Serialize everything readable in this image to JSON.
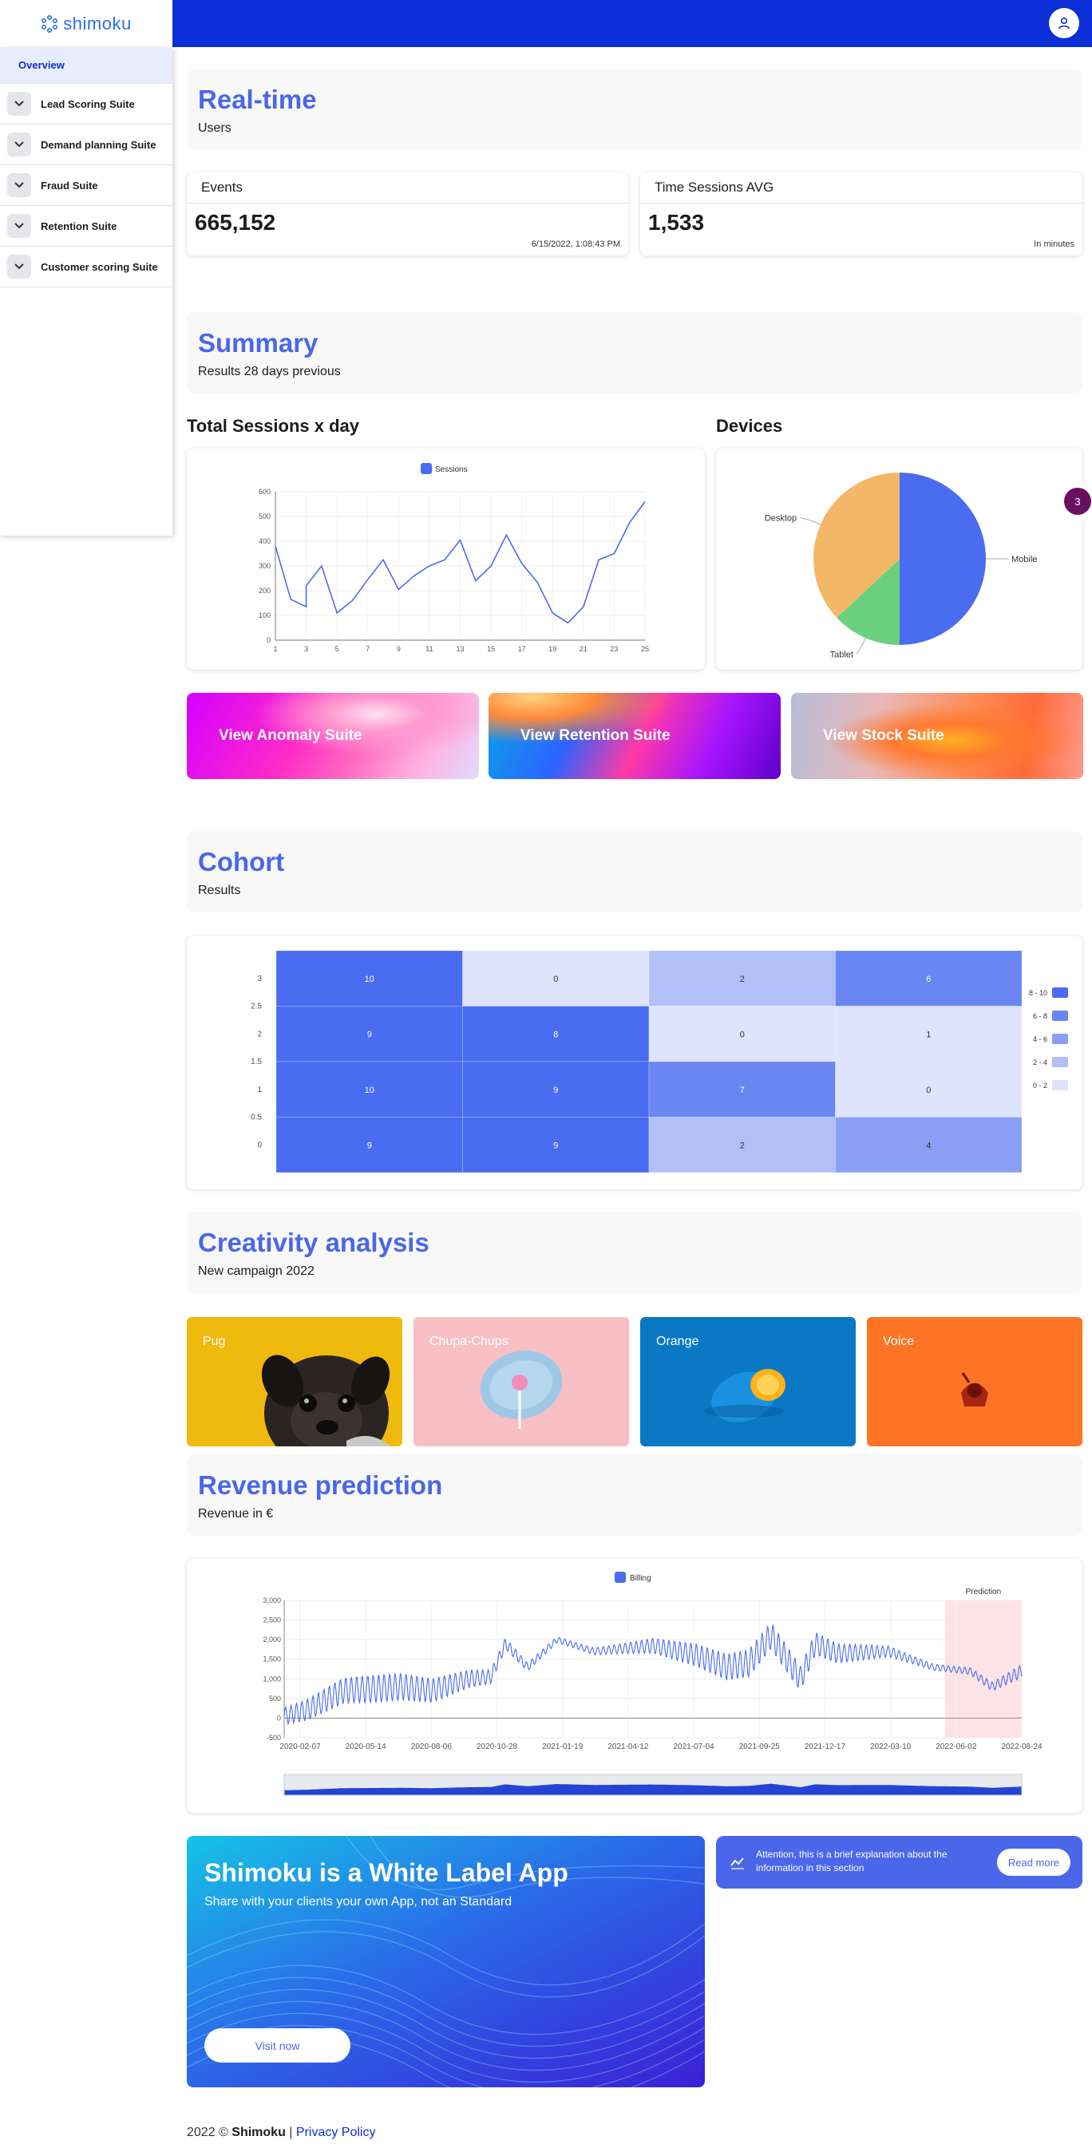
{
  "app": {
    "logo_text": "shimoku"
  },
  "sidebar": {
    "overview": "Overview",
    "items": [
      {
        "label": "Lead Scoring Suite"
      },
      {
        "label": "Demand planning Suite"
      },
      {
        "label": "Fraud Suite"
      },
      {
        "label": "Retention Suite"
      },
      {
        "label": "Customer scoring Suite"
      }
    ]
  },
  "realtime": {
    "title": "Real-time",
    "subtitle": "Users"
  },
  "indicators": [
    {
      "title": "Events",
      "value": "665,152",
      "footer": "6/15/2022, 1:08:43 PM"
    },
    {
      "title": "Time Sessions AVG",
      "value": "1,533",
      "footer": "In minutes"
    }
  ],
  "summary": {
    "title": "Summary",
    "subtitle": "Results 28 days previous"
  },
  "sessions_label": "Total Sessions x day",
  "devices_label": "Devices",
  "badge": "3",
  "view_cards": [
    {
      "label": "View Anomaly Suite"
    },
    {
      "label": "View Retention Suite"
    },
    {
      "label": "View Stock Suite"
    }
  ],
  "cohort": {
    "title": "Cohort",
    "subtitle": "Results"
  },
  "creativity": {
    "title": "Creativity analysis",
    "subtitle": "New campaign 2022"
  },
  "creativity_cards": [
    {
      "label": "Pug"
    },
    {
      "label": "Chupa-Chups"
    },
    {
      "label": "Orange"
    },
    {
      "label": "Voice"
    }
  ],
  "revenue": {
    "title": "Revenue prediction",
    "subtitle": "Revenue in €"
  },
  "white_label": {
    "title": "Shimoku is a White Label App",
    "subtitle": "Share with your clients your own App, not an Standard",
    "button": "Visit now"
  },
  "attention": {
    "text": "Attention, this is a brief explanation about the information in this section",
    "button": "Read more"
  },
  "footer": {
    "prefix": "2022 © ",
    "brand": "Shimoku",
    "sep": " | ",
    "link": "Privacy Policy"
  },
  "colors": {
    "accent": "#4a67ea",
    "topbar": "#0a2fd6"
  },
  "chart_data": [
    {
      "type": "line",
      "legend": [
        "Sessions"
      ],
      "x": [
        1,
        2,
        3,
        3,
        4,
        5,
        6,
        7,
        8,
        9,
        10,
        11,
        12,
        13,
        14,
        15,
        16,
        17,
        18,
        19,
        20,
        21,
        22,
        23,
        24,
        25
      ],
      "series": [
        {
          "name": "Sessions",
          "values": [
            380,
            165,
            135,
            220,
            300,
            110,
            160,
            245,
            325,
            205,
            260,
            300,
            325,
            405,
            240,
            300,
            425,
            310,
            235,
            110,
            70,
            135,
            325,
            350,
            475,
            560
          ]
        }
      ],
      "x_ticks": [
        "1",
        "3",
        "5",
        "7",
        "9",
        "11",
        "13",
        "15",
        "17",
        "19",
        "21",
        "23",
        "25"
      ],
      "y_ticks": [
        "0",
        "100",
        "200",
        "300",
        "400",
        "500",
        "600"
      ],
      "ylim": [
        0,
        600
      ],
      "grid": true,
      "legend_position": "top"
    },
    {
      "type": "pie",
      "slices": [
        {
          "label": "Mobile",
          "value": 50,
          "color": "#4a6cf0"
        },
        {
          "label": "Tablet",
          "value": 13,
          "color": "#6bd07e"
        },
        {
          "label": "Desktop",
          "value": 37,
          "color": "#f2b867"
        }
      ]
    },
    {
      "type": "heatmap",
      "y_ticks": [
        "3",
        "2.5",
        "2",
        "1.5",
        "1",
        "0.5",
        "0"
      ],
      "rows": [
        {
          "y": 3,
          "values": [
            10,
            0,
            2,
            6
          ]
        },
        {
          "y": 2,
          "values": [
            9,
            8,
            0,
            1
          ]
        },
        {
          "y": 1,
          "values": [
            10,
            9,
            7,
            0
          ]
        },
        {
          "y": 0,
          "values": [
            9,
            9,
            2,
            4
          ]
        }
      ],
      "legend": [
        "8 - 10",
        "6 - 8",
        "4 - 6",
        "2 - 4",
        "0 - 2"
      ],
      "legend_colors": [
        "#4a6cf0",
        "#6a86f2",
        "#8aa0f4",
        "#b2c0f7",
        "#dde4fb"
      ]
    },
    {
      "type": "line",
      "legend": [
        "Billing"
      ],
      "series_name": "Billing",
      "x_ticks": [
        "2020-02-07",
        "2020-05-14",
        "2020-08-06",
        "2020-10-28",
        "2021-01-19",
        "2021-04-12",
        "2021-07-04",
        "2021-09-25",
        "2021-12-17",
        "2022-03-10",
        "2022-06-02",
        "2022-08-24"
      ],
      "y_ticks": [
        "-500",
        "0",
        "500",
        "1,000",
        "1,500",
        "2,000",
        "2,500",
        "3,000"
      ],
      "ylim": [
        -500,
        3000
      ],
      "annotation": "Prediction",
      "prediction_start": "2022-06-02",
      "trend": [
        {
          "t": 0.0,
          "v": 50
        },
        {
          "t": 0.03,
          "v": 200
        },
        {
          "t": 0.08,
          "v": 700
        },
        {
          "t": 0.16,
          "v": 800
        },
        {
          "t": 0.2,
          "v": 700
        },
        {
          "t": 0.25,
          "v": 1000
        },
        {
          "t": 0.28,
          "v": 1050
        },
        {
          "t": 0.3,
          "v": 1900
        },
        {
          "t": 0.33,
          "v": 1300
        },
        {
          "t": 0.37,
          "v": 2000
        },
        {
          "t": 0.42,
          "v": 1700
        },
        {
          "t": 0.5,
          "v": 1850
        },
        {
          "t": 0.56,
          "v": 1600
        },
        {
          "t": 0.6,
          "v": 1300
        },
        {
          "t": 0.63,
          "v": 1400
        },
        {
          "t": 0.66,
          "v": 2100
        },
        {
          "t": 0.7,
          "v": 1000
        },
        {
          "t": 0.72,
          "v": 1900
        },
        {
          "t": 0.75,
          "v": 1650
        },
        {
          "t": 0.82,
          "v": 1700
        },
        {
          "t": 0.88,
          "v": 1300
        },
        {
          "t": 0.93,
          "v": 1200
        },
        {
          "t": 0.96,
          "v": 800
        },
        {
          "t": 1.0,
          "v": 1200
        }
      ]
    }
  ]
}
